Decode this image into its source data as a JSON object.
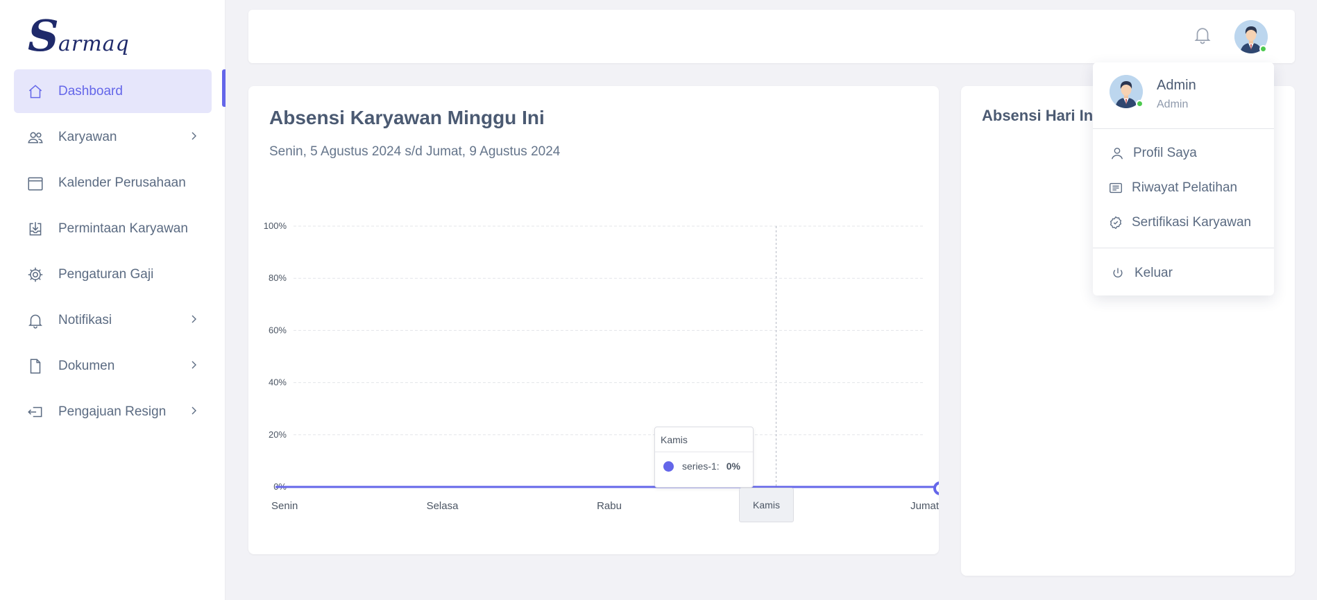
{
  "brand": {
    "logo_initial": "S",
    "logo_rest": "armaq"
  },
  "sidebar": {
    "items": [
      {
        "label": "Dashboard",
        "icon": "home-icon",
        "active": true,
        "has_children": false
      },
      {
        "label": "Karyawan",
        "icon": "users-icon",
        "active": false,
        "has_children": true
      },
      {
        "label": "Kalender Perusahaan",
        "icon": "calendar-icon",
        "active": false,
        "has_children": false
      },
      {
        "label": "Permintaan Karyawan",
        "icon": "inbox-download-icon",
        "active": false,
        "has_children": false
      },
      {
        "label": "Pengaturan Gaji",
        "icon": "gear-icon",
        "active": false,
        "has_children": false
      },
      {
        "label": "Notifikasi",
        "icon": "bell-icon",
        "active": false,
        "has_children": true
      },
      {
        "label": "Dokumen",
        "icon": "document-icon",
        "active": false,
        "has_children": true
      },
      {
        "label": "Pengajuan Resign",
        "icon": "exit-icon",
        "active": false,
        "has_children": true
      }
    ],
    "accent": "#6466e9"
  },
  "attendance_card": {
    "title": "Absensi Karyawan Minggu Ini",
    "subtitle": "Senin, 5 Agustus 2024 s/d Jumat, 9 Agustus 2024"
  },
  "today_card": {
    "title": "Absensi Hari Ini"
  },
  "chart_data": {
    "type": "line",
    "categories": [
      "Senin",
      "Selasa",
      "Rabu",
      "Kamis",
      "Jumat"
    ],
    "series": [
      {
        "name": "series-1",
        "values": [
          0,
          0,
          0,
          0,
          0
        ]
      }
    ],
    "ylim": [
      0,
      100
    ],
    "yticks": [
      "0%",
      "20%",
      "40%",
      "60%",
      "80%",
      "100%"
    ],
    "grid": true,
    "color": "#6466e9",
    "tooltip": {
      "category": "Kamis",
      "series_label": "series-1:",
      "value": "0%"
    }
  },
  "user_menu": {
    "name": "Admin",
    "role": "Admin",
    "items": [
      {
        "label": "Profil Saya",
        "icon": "user-icon"
      },
      {
        "label": "Riwayat Pelatihan",
        "icon": "list-icon"
      },
      {
        "label": "Sertifikasi Karyawan",
        "icon": "badge-check-icon"
      }
    ],
    "logout_label": "Keluar"
  }
}
